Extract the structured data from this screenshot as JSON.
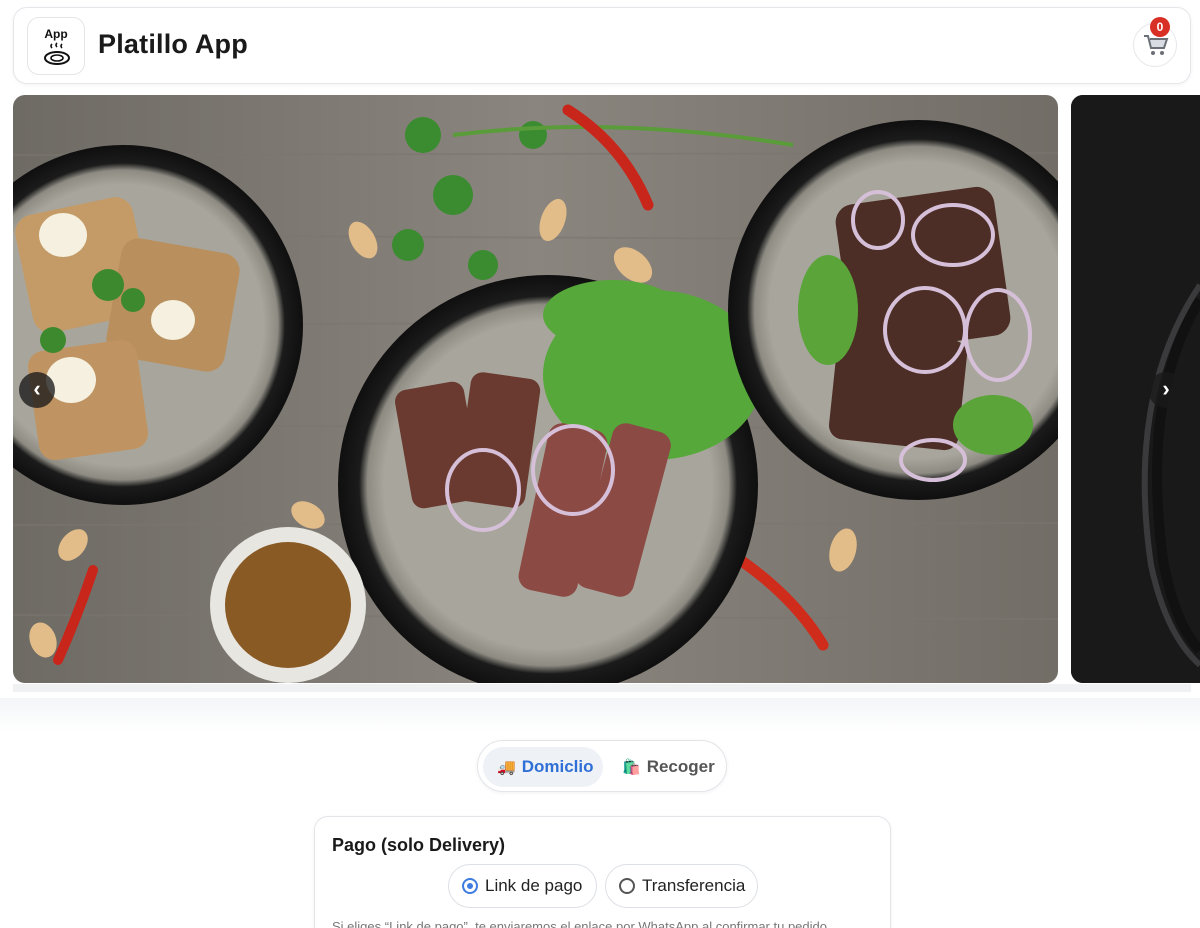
{
  "header": {
    "logo_text": "App",
    "title": "Platillo App",
    "cart_count": "0"
  },
  "carousel": {
    "prev_label": "‹",
    "next_label": "›"
  },
  "delivery_toggle": {
    "options": [
      {
        "icon": "🚚",
        "label": "Domiclio",
        "selected": true
      },
      {
        "icon": "🛍️",
        "label": "Recoger",
        "selected": false
      }
    ]
  },
  "payment": {
    "title": "Pago (solo Delivery)",
    "options": [
      {
        "label": "Link de pago",
        "selected": true
      },
      {
        "label": "Transferencia",
        "selected": false
      }
    ],
    "note": "Si eliges “Link de pago”, te enviaremos el enlace por WhatsApp al confirmar tu pedido."
  },
  "colors": {
    "accent": "#2f6fd6",
    "badge": "#d93025"
  }
}
